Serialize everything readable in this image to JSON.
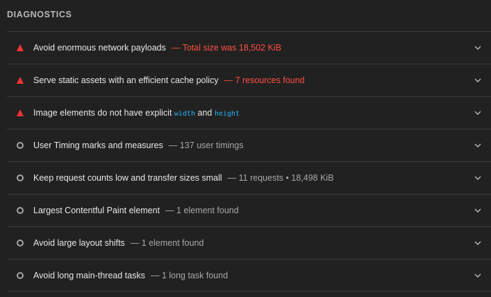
{
  "section": {
    "title": "DIAGNOSTICS"
  },
  "colors": {
    "fail": "#ff4e42",
    "info": "#a8a8a8",
    "code": "#29b6f6",
    "background": "#212121"
  },
  "audits": [
    {
      "status": "fail",
      "status_icon": "warning-triangle-icon",
      "title": "Avoid enormous network payloads",
      "detail": "Total size was 18,502 KiB"
    },
    {
      "status": "fail",
      "status_icon": "warning-triangle-icon",
      "title": "Serve static assets with an efficient cache policy",
      "detail": "7 resources found"
    },
    {
      "status": "fail",
      "status_icon": "warning-triangle-icon",
      "title_before": "Image elements do not have explicit",
      "code1": "width",
      "title_mid": "and",
      "code2": "height"
    },
    {
      "status": "info",
      "status_icon": "info-circle-icon",
      "title": "User Timing marks and measures",
      "detail": "137 user timings"
    },
    {
      "status": "info",
      "status_icon": "info-circle-icon",
      "title": "Keep request counts low and transfer sizes small",
      "detail": "11 requests • 18,498 KiB"
    },
    {
      "status": "info",
      "status_icon": "info-circle-icon",
      "title": "Largest Contentful Paint element",
      "detail": "1 element found"
    },
    {
      "status": "info",
      "status_icon": "info-circle-icon",
      "title": "Avoid large layout shifts",
      "detail": "1 element found"
    },
    {
      "status": "info",
      "status_icon": "info-circle-icon",
      "title": "Avoid long main-thread tasks",
      "detail": "1 long task found"
    }
  ],
  "separator": "—",
  "expand_icon": "chevron-down-icon"
}
